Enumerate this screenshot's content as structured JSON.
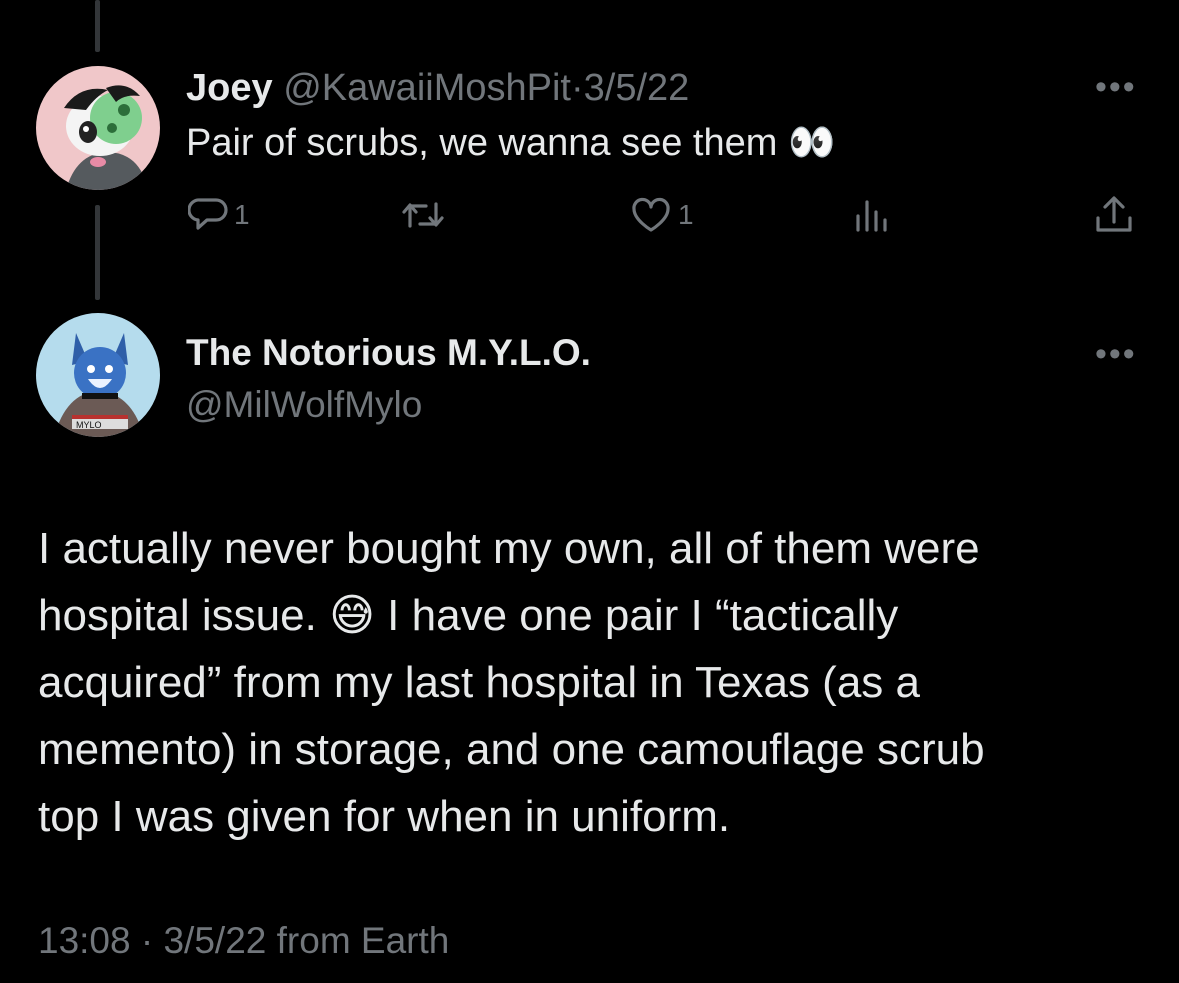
{
  "reply_tweet": {
    "display_name": "Joey",
    "handle": "@KawaiiMoshPit",
    "separator": "·",
    "date": "3/5/22",
    "text": "Pair of scrubs, we wanna see them",
    "emoji": "👀",
    "actions": {
      "reply_count": "1",
      "like_count": "1"
    }
  },
  "main_tweet": {
    "display_name": "The Notorious M.Y.L.O.",
    "handle": "@MilWolfMylo",
    "body": {
      "line1": "I actually never bought my own, all of them were",
      "line2_a": "hospital issue.",
      "line2_emoji": "😅",
      "line2_b": "I have one pair I “tactically",
      "line3": "acquired” from my last hospital in Texas (as a",
      "line4": "memento) in storage, and one camouflage scrub",
      "line5": "top I was given for when in uniform."
    },
    "meta": {
      "time": "13:08",
      "separator": "·",
      "date": "3/5/22",
      "source": "from Earth"
    }
  },
  "icons": [
    "reply-icon",
    "retweet-icon",
    "like-icon",
    "views-icon",
    "share-icon",
    "more-icon"
  ],
  "colors": {
    "background": "#000000",
    "text": "#e7e9ea",
    "muted": "#71767b",
    "thread_line": "#333639"
  }
}
